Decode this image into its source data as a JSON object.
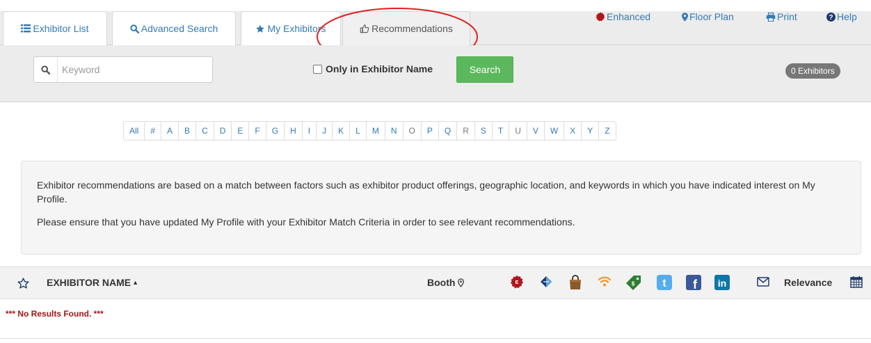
{
  "tabs": [
    {
      "label": "Exhibitor List",
      "icon": "list-icon"
    },
    {
      "label": "Advanced Search",
      "icon": "search-icon"
    },
    {
      "label": "My Exhibitors",
      "icon": "star-icon"
    },
    {
      "label": "Recommendations",
      "icon": "thumbs-up-icon",
      "active": true
    }
  ],
  "toolbar": {
    "enhanced": "Enhanced",
    "floor_plan": "Floor Plan",
    "print": "Print",
    "help": "Help"
  },
  "search": {
    "placeholder": "Keyword",
    "value": "",
    "only_name_label": "Only in Exhibitor Name",
    "only_name_checked": false,
    "button_label": "Search",
    "count_badge": "0 Exhibitors"
  },
  "alphabet": [
    "All",
    "#",
    "A",
    "B",
    "C",
    "D",
    "E",
    "F",
    "G",
    "H",
    "I",
    "J",
    "K",
    "L",
    "M",
    "N",
    "O",
    "P",
    "Q",
    "R",
    "S",
    "T",
    "U",
    "V",
    "W",
    "X",
    "Y",
    "Z"
  ],
  "info": {
    "paragraph1": "Exhibitor recommendations are based on a match between factors such as exhibitor product offerings, geographic location, and keywords in which you have indicated interest on My Profile.",
    "paragraph2": "Please ensure that you have updated My Profile with your Exhibitor Match Criteria in order to see relevant recommendations."
  },
  "results_header": {
    "name_label": "EXHIBITOR NAME",
    "booth_label": "Booth",
    "relevance_label": "Relevance",
    "icons": [
      "enhanced-badge-icon",
      "diamond-icon",
      "shopping-bag-icon",
      "wifi-icon",
      "price-tag-icon",
      "twitter-icon",
      "facebook-icon",
      "linkedin-icon",
      "envelope-icon"
    ]
  },
  "results": {
    "empty_message": "*** No Results Found. ***"
  },
  "colors": {
    "link": "#337ab7",
    "search_button": "#5cb85c",
    "badge": "#777777",
    "error_text": "#a31515",
    "annotation": "#e02020"
  }
}
